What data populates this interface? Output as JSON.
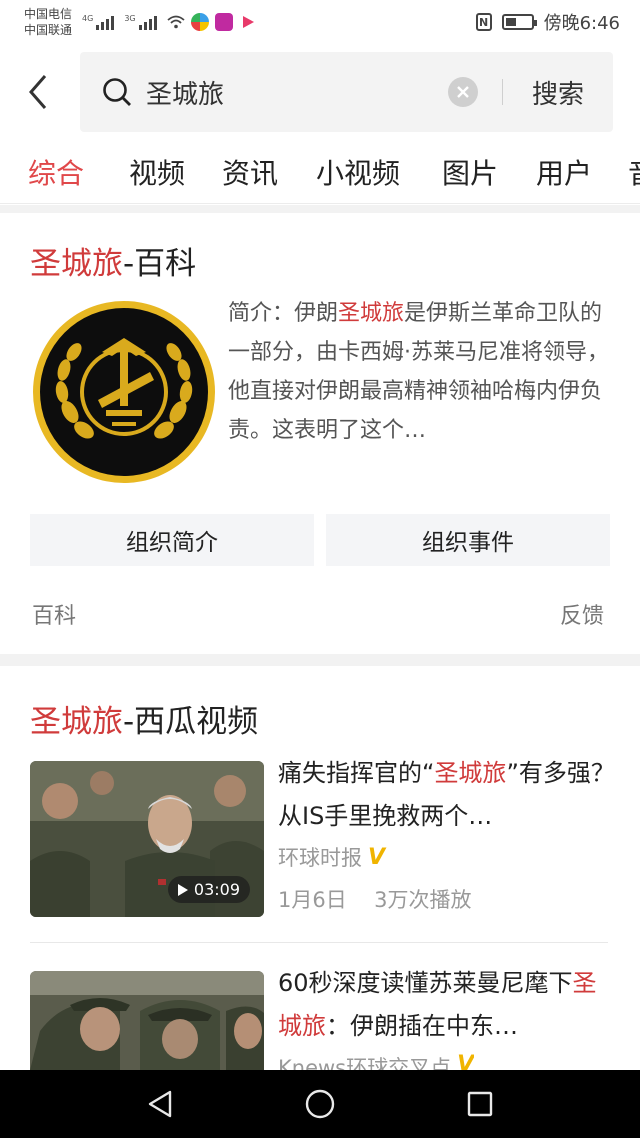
{
  "status_bar": {
    "carrier_1": "中国电信",
    "carrier_2": "中国联通",
    "signal_1_tag": "4G",
    "signal_2_tag": "3G",
    "time": "傍晚6:46",
    "nfc": "N",
    "battery_level": 0.45
  },
  "search": {
    "query": "圣城旅",
    "button_label": "搜索"
  },
  "tabs": [
    "综合",
    "视频",
    "资讯",
    "小视频",
    "图片",
    "用户",
    "音"
  ],
  "active_tab": "综合",
  "wiki_card": {
    "title_keyword": "圣城旅",
    "title_suffix": "-百科",
    "desc_prefix": "简介：伊朗",
    "desc_keyword": "圣城旅",
    "desc_rest": "是伊斯兰革命卫队的一部分，由卡西姆·苏莱马尼准将领导，他直接对伊朗最高精神领袖哈梅内伊负责。这表明了这个…",
    "button_1": "组织简介",
    "button_2": "组织事件",
    "footer_left": "百科",
    "footer_right": "反馈"
  },
  "video_card": {
    "title_keyword": "圣城旅",
    "title_suffix": "-西瓜视频",
    "items": [
      {
        "title_prefix": "痛失指挥官的“",
        "title_keyword": "圣城旅",
        "title_rest": "”有多强？从IS手里挽救两个…",
        "source": "环球时报",
        "date": "1月6日",
        "plays": "3万次播放",
        "duration": "03:09"
      },
      {
        "title_prefix": "60秒深度读懂苏莱曼尼麾下",
        "title_keyword": "圣城旅",
        "title_rest": "：伊朗插在中东…",
        "source": "Knews环球交叉点"
      }
    ]
  },
  "colors": {
    "accent": "#d03b3b",
    "tab_active": "#e0484a",
    "verified_badge": "#f0b400"
  }
}
